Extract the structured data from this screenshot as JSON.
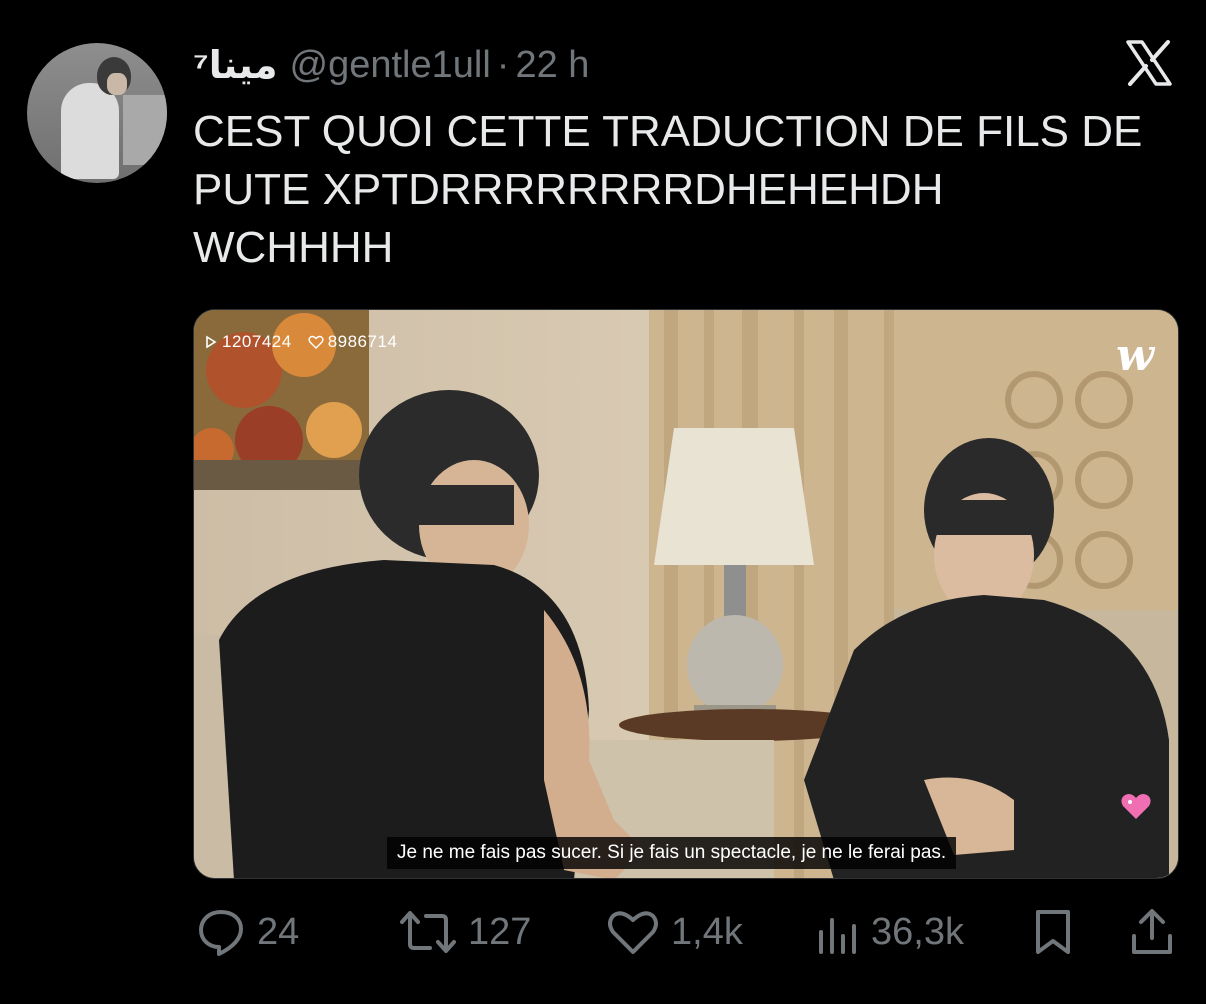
{
  "tweet": {
    "display_name": "مينا⁷",
    "handle": "@gentle1ull",
    "separator": "·",
    "time": "22 h",
    "text_lines": [
      "CEST QUOI CETTE TRADUCTION DE FILS DE",
      "PUTE XPTDRRRRRRRRDHEHEHDH",
      "WCHHHH"
    ]
  },
  "media": {
    "play_count": "1207424",
    "like_count": "8986714",
    "watermark": "w",
    "subtitle": "Je ne me fais pas sucer. Si je fais un spectacle, je ne le ferai pas."
  },
  "actions": {
    "replies": "24",
    "retweets": "127",
    "likes": "1,4k",
    "views": "36,3k"
  },
  "colors": {
    "background": "#000000",
    "text": "#e7e9ea",
    "muted": "#71767b",
    "accent_pink": "#f06fb3"
  },
  "icons": [
    "x-logo-icon",
    "play-icon",
    "heart-outline-icon",
    "heart-badge-icon",
    "reply-icon",
    "retweet-icon",
    "like-icon",
    "views-icon",
    "bookmark-icon",
    "share-icon"
  ]
}
